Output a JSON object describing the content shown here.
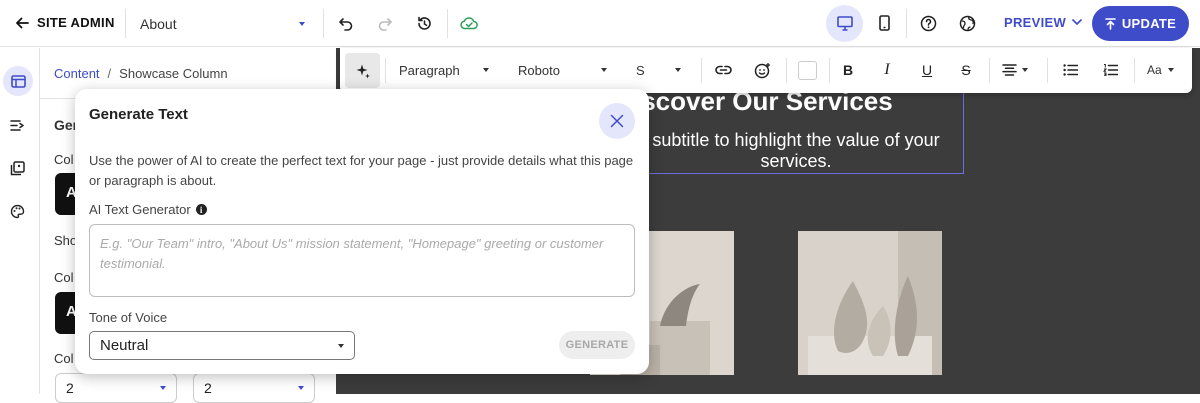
{
  "topbar": {
    "site_admin": "SITE ADMIN",
    "page_select": "About",
    "preview_label": "PREVIEW",
    "update_label": "UPDATE",
    "accent": "#3f4cc9"
  },
  "breadcrumb": {
    "root": "Content",
    "separator": "/",
    "current": "Showcase Column"
  },
  "panel": {
    "section_title_partial": "Gen",
    "label_1_partial": "Col",
    "label_2_partial": "Sho",
    "label_3_partial": "Col",
    "label_4_partial": "Col",
    "tile_1_letter": "A",
    "tile_2_letter": "A",
    "select_1_value": "2",
    "select_2_value": "2"
  },
  "canvas": {
    "hero_title_partial": "iscover Our Services",
    "hero_subtitle_partial": "subtitle to highlight the value of your services."
  },
  "format_toolbar": {
    "block_type": "Paragraph",
    "font": "Roboto",
    "size": "S",
    "text_size_label": "Aa"
  },
  "modal": {
    "title": "Generate Text",
    "description": "Use the power of AI to create the perfect text for your page - just provide details what this page or paragraph is about.",
    "generator_label": "AI Text Generator",
    "textarea_placeholder": "E.g. \"Our Team\" intro, \"About Us\" mission statement, \"Homepage\" greeting or customer testimonial.",
    "tone_label": "Tone of Voice",
    "tone_value": "Neutral",
    "generate_label": "GENERATE"
  }
}
